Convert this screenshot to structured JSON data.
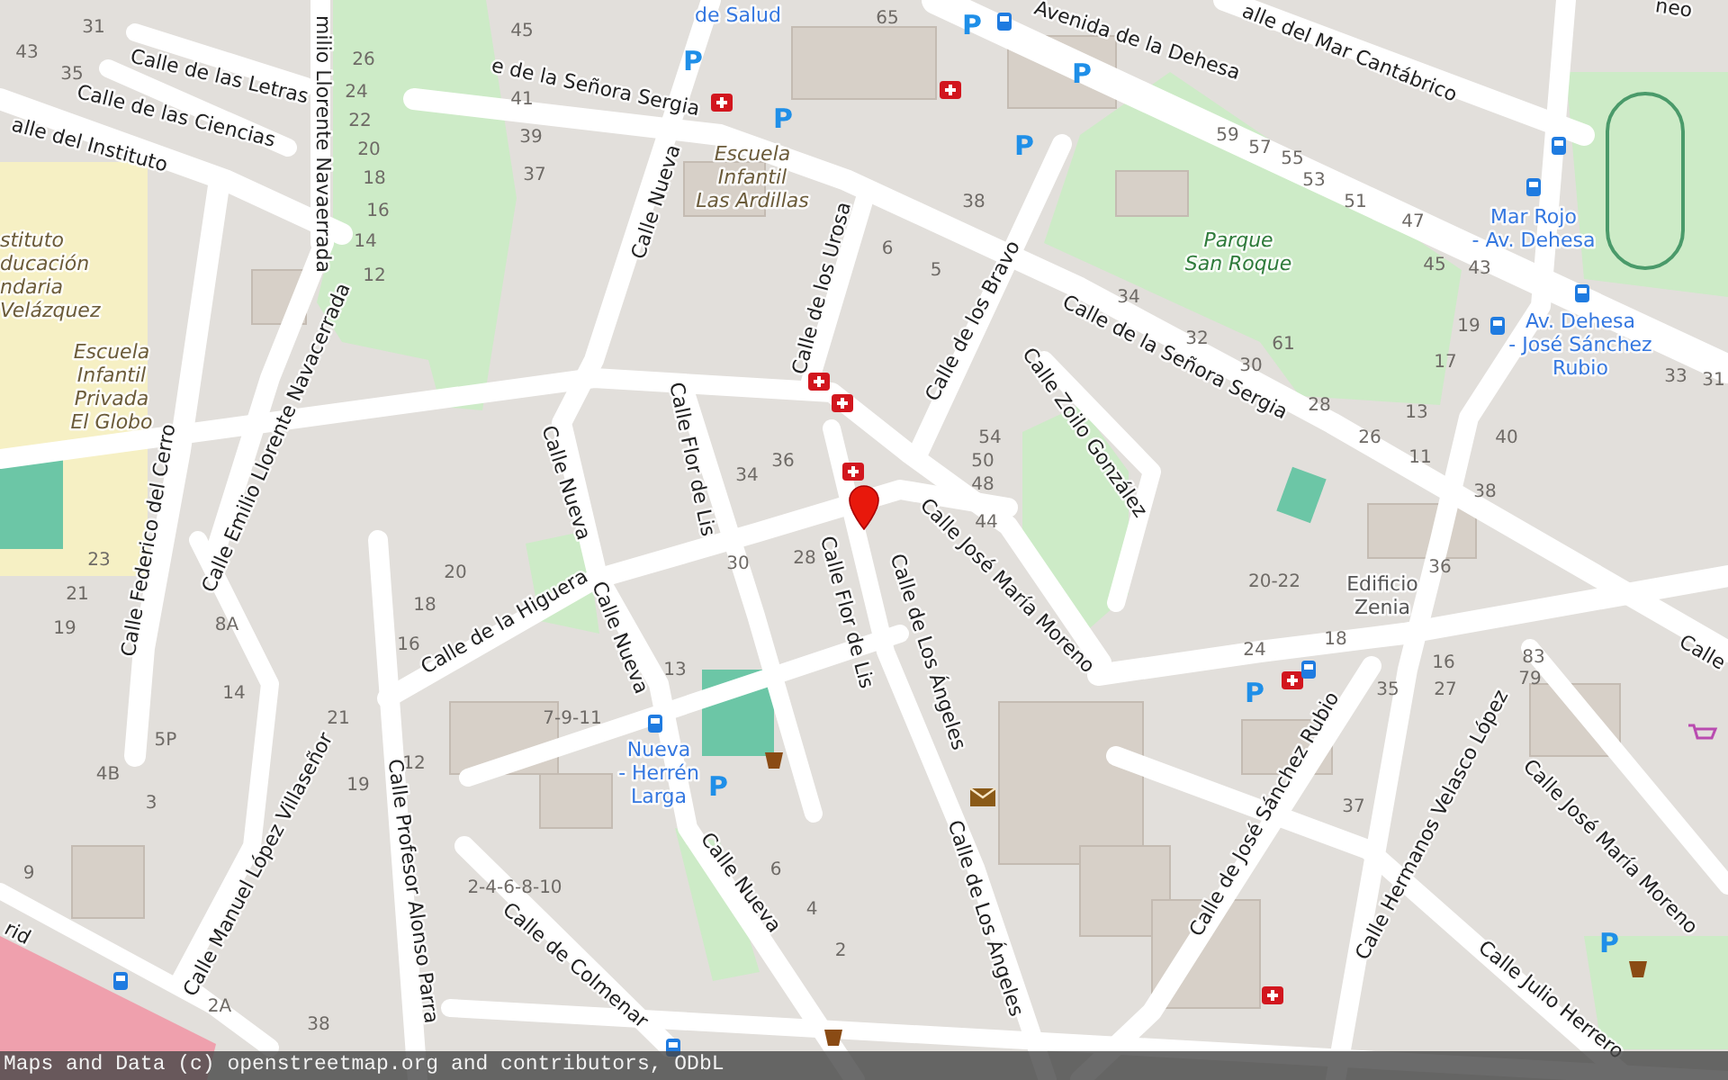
{
  "map": {
    "streets": [
      {
        "name": "Calle de las Letras"
      },
      {
        "name": "Calle de las Ciencias"
      },
      {
        "name": "alle del Instituto"
      },
      {
        "name": "milio Llorente Navaerrada"
      },
      {
        "name": "Calle Emilio Llorente Navacerrada"
      },
      {
        "name": "Calle Federico del Cerro"
      },
      {
        "name": "e de la Señora Sergia"
      },
      {
        "name": "Calle Nueva"
      },
      {
        "name": "Calle de los Urosa"
      },
      {
        "name": "Calle de los Bravo"
      },
      {
        "name": "Calle de la Señora Sergia"
      },
      {
        "name": "Calle Zoilo González"
      },
      {
        "name": "Avenida de la Dehesa"
      },
      {
        "name": "alle del Mar Cantábrico"
      },
      {
        "name": "neo"
      },
      {
        "name": "Calle José María Moreno"
      },
      {
        "name": "Calle Flor de Lis"
      },
      {
        "name": "Calle Flor de Lis"
      },
      {
        "name": "Calle de Los Ángeles"
      },
      {
        "name": "Calle de Los Ángeles"
      },
      {
        "name": "Calle Nueva"
      },
      {
        "name": "Calle Nueva"
      },
      {
        "name": "Calle Nueva"
      },
      {
        "name": "Calle de la Higuera"
      },
      {
        "name": "Calle Manuel López Villaseñor"
      },
      {
        "name": "Calle Profesor Alonso Parra"
      },
      {
        "name": "Calle de Colmenar"
      },
      {
        "name": "Calle de José Sánchez Rubio"
      },
      {
        "name": "Calle Hermanos Velasco López"
      },
      {
        "name": "Calle José María Moreno"
      },
      {
        "name": "Calle Julio Herrero"
      },
      {
        "name": "rid"
      },
      {
        "name": "Calle"
      }
    ],
    "places": [
      {
        "kind": "health",
        "lines": [
          "de Salud"
        ]
      },
      {
        "kind": "school",
        "lines": [
          "Escuela",
          "Infantil",
          "Las Ardillas"
        ]
      },
      {
        "kind": "park",
        "lines": [
          "Parque",
          "San Roque"
        ]
      },
      {
        "kind": "transit",
        "lines": [
          "Mar Rojo",
          "- Av. Dehesa"
        ]
      },
      {
        "kind": "transit",
        "lines": [
          "Av. Dehesa",
          "- José Sánchez",
          "Rubio"
        ]
      },
      {
        "kind": "school",
        "lines": [
          "stituto",
          "ducación",
          "ndaria",
          "Velázquez"
        ]
      },
      {
        "kind": "school",
        "lines": [
          "Escuela",
          "Infantil",
          "Privada",
          "El Globo"
        ]
      },
      {
        "kind": "transit",
        "lines": [
          "Nueva",
          "- Herrén",
          "Larga"
        ]
      },
      {
        "kind": "building",
        "lines": [
          "Edificio",
          "Zenia"
        ]
      }
    ],
    "house_numbers": [
      "31",
      "43",
      "35",
      "45",
      "26",
      "24",
      "22",
      "20",
      "18",
      "16",
      "14",
      "12",
      "41",
      "39",
      "37",
      "65",
      "38",
      "6",
      "5",
      "34",
      "59",
      "57",
      "55",
      "53",
      "51",
      "47",
      "45",
      "43",
      "19",
      "17",
      "61",
      "32",
      "30",
      "28",
      "26",
      "13",
      "11",
      "40",
      "38",
      "33",
      "31",
      "54",
      "50",
      "48",
      "44",
      "36",
      "34",
      "20-22",
      "24",
      "18",
      "36",
      "16",
      "83",
      "79",
      "35",
      "27",
      "37",
      "23",
      "21",
      "19",
      "20",
      "18",
      "16",
      "30",
      "28",
      "13",
      "8A",
      "14",
      "21",
      "19",
      "12",
      "7-9-11",
      "2-4-6-8-10",
      "6",
      "4",
      "2",
      "5P",
      "4B",
      "3",
      "9",
      "2A",
      "38"
    ],
    "parking_signs": [
      "P",
      "P",
      "P",
      "P",
      "P",
      "P",
      "P",
      "P"
    ]
  },
  "attribution": "Maps and Data (c) openstreetmap.org and contributors, ODbL"
}
